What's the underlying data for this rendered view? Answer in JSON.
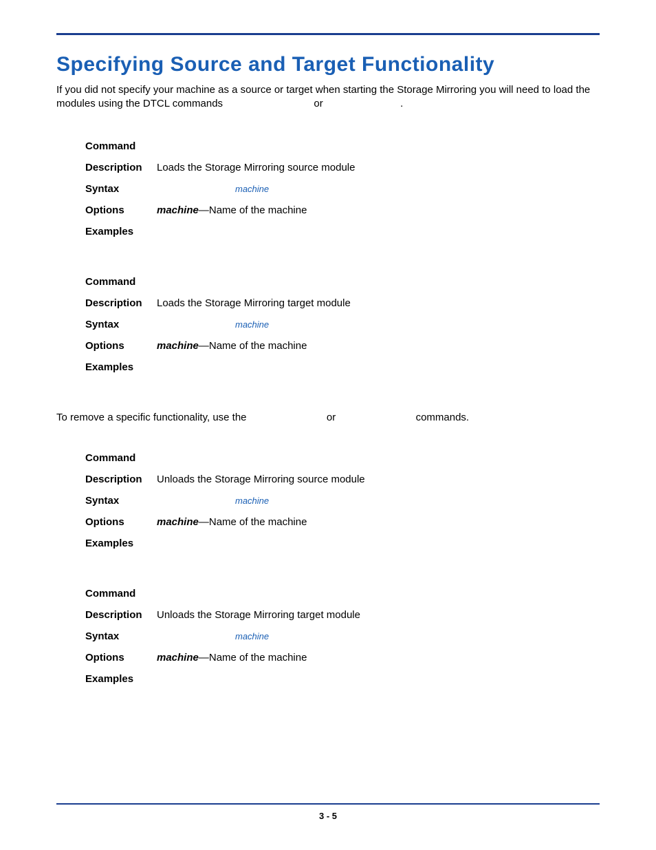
{
  "title": "Specifying Source and Target Functionality",
  "intro_a": "If you did not specify your machine as a source or target when starting the Storage Mirroring you will need to load the modules using the DTCL commands",
  "intro_or": "or",
  "intro_end": ".",
  "labels": {
    "command": "Command",
    "description": "Description",
    "syntax": "Syntax",
    "options": "Options",
    "examples": "Examples"
  },
  "syntax_var": "machine",
  "option_var": "machine",
  "option_rest": "—Name of the machine",
  "blocks": [
    {
      "description": "Loads the Storage Mirroring source module"
    },
    {
      "description": "Loads the Storage Mirroring target module"
    },
    {
      "description": "Unloads the Storage Mirroring source module"
    },
    {
      "description": "Unloads the Storage Mirroring target module"
    }
  ],
  "mid_a": "To remove a specific functionality, use the",
  "mid_or": "or",
  "mid_end": "commands.",
  "pagenum": "3 - 5"
}
